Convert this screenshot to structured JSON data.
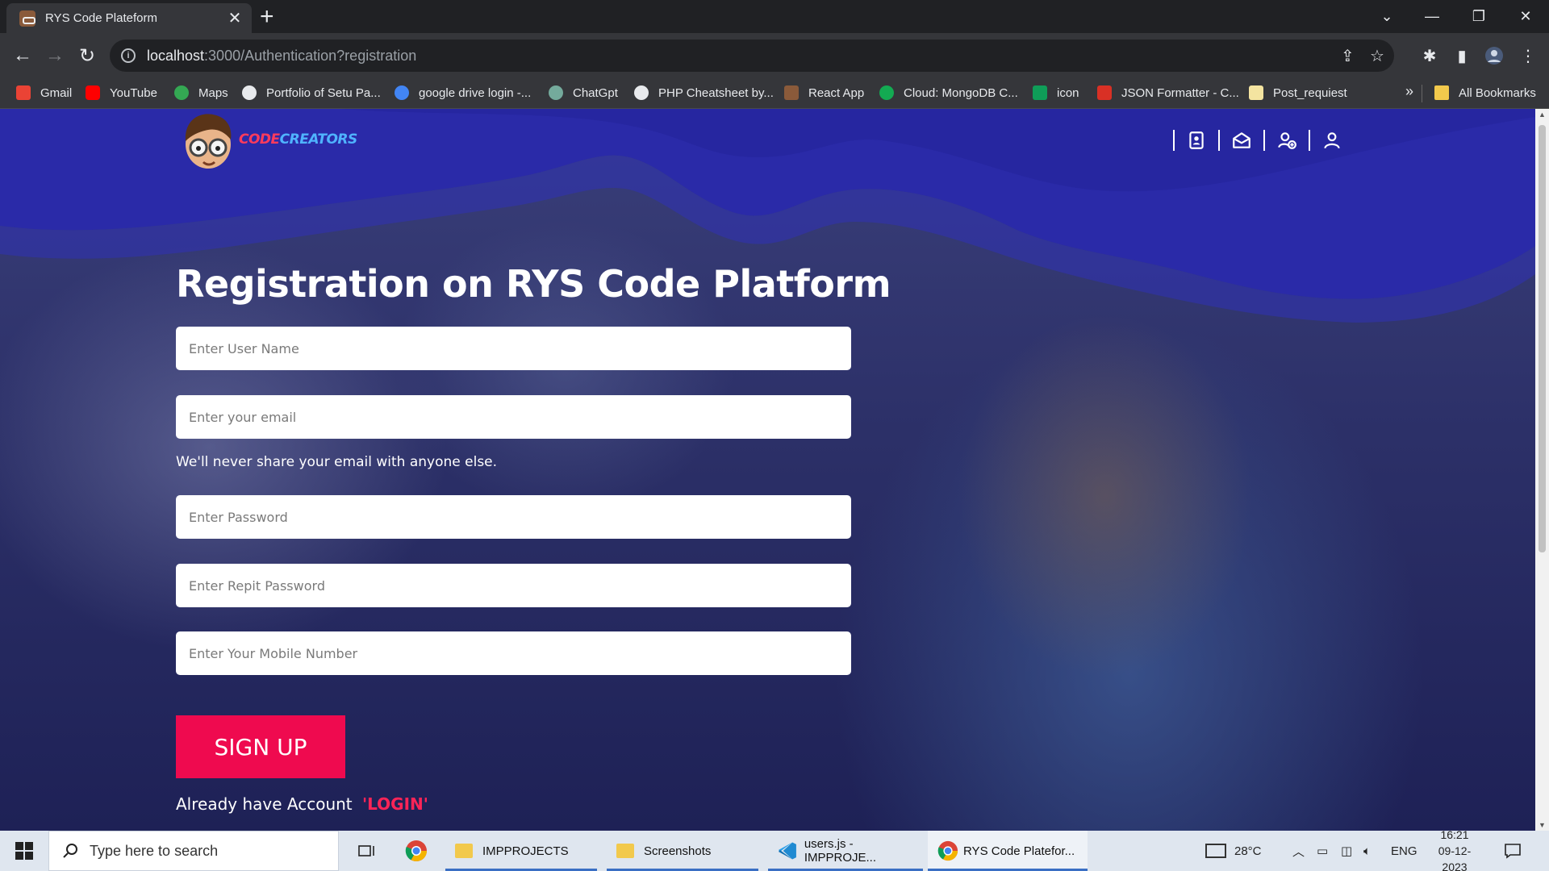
{
  "browser": {
    "tab_title": "RYS Code Plateform",
    "tab_close": "✕",
    "new_tab": "+",
    "url_host": "localhost",
    "url_path": ":3000/Authentication?registration",
    "window_controls": [
      "⌄",
      "—",
      "❐",
      "✕"
    ],
    "bookmarks": [
      {
        "label": "Gmail",
        "color": "#ea4335"
      },
      {
        "label": "YouTube",
        "color": "#ff0000"
      },
      {
        "label": "Maps",
        "color": "#34a853"
      },
      {
        "label": "Portfolio of Setu Pa...",
        "color": "#e8eaed"
      },
      {
        "label": "google drive login -...",
        "color": "#4285f4"
      },
      {
        "label": "ChatGpt",
        "color": "#74aa9c"
      },
      {
        "label": "PHP Cheatsheet by...",
        "color": "#e8eaed"
      },
      {
        "label": "React App",
        "color": "#8a5a3a"
      },
      {
        "label": "Cloud: MongoDB C...",
        "color": "#13aa52"
      },
      {
        "label": "icon",
        "color": "#0f9d58"
      },
      {
        "label": "JSON Formatter - C...",
        "color": "#d93025"
      },
      {
        "label": "Post_requiest",
        "color": "#f4e4a0"
      }
    ],
    "more_bookmarks": "»",
    "all_bookmarks": "All Bookmarks"
  },
  "site": {
    "logo_part1": "CODE",
    "logo_part2": "CREATORS",
    "heading": "Registration on RYS Code Platform",
    "fields": {
      "username_placeholder": "Enter User Name",
      "email_placeholder": "Enter your email",
      "password_placeholder": "Enter Password",
      "repeat_password_placeholder": "Enter Repit Password",
      "mobile_placeholder": "Enter Your Mobile Number"
    },
    "email_hint": "We'll never share your email with anyone else.",
    "signup_label": "SIGN UP",
    "already_text": "Already have Account",
    "login_link": "'LOGIN'",
    "colors": {
      "accent": "#ef0a4f",
      "header": "#2a2aa8"
    }
  },
  "taskbar": {
    "search_placeholder": "Type here to search",
    "apps": [
      {
        "label": "IMPPROJECTS"
      },
      {
        "label": "Screenshots"
      },
      {
        "label": "users.js - IMPPROJE..."
      },
      {
        "label": "RYS Code Platefor..."
      }
    ],
    "weather": "28°C",
    "language": "ENG",
    "time": "16:21",
    "date": "09-12-2023"
  }
}
